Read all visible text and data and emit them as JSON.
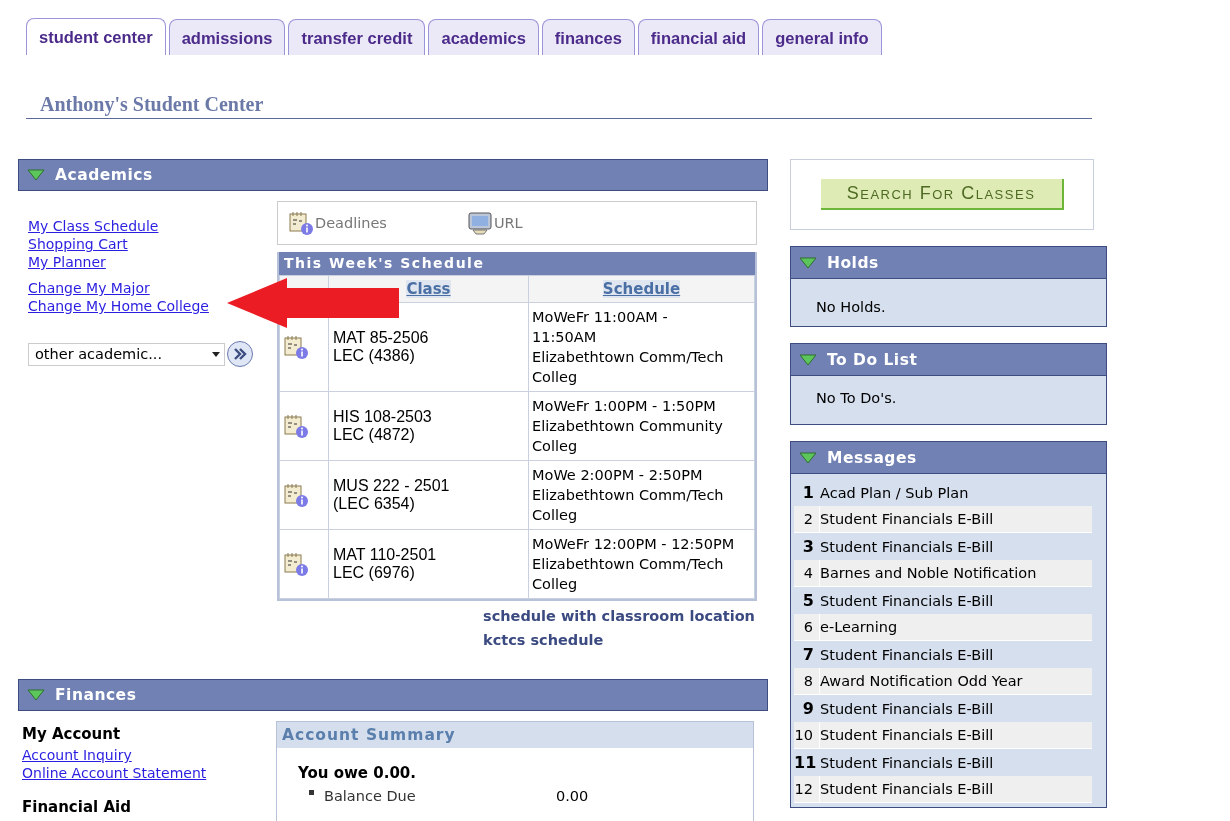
{
  "tabs": [
    {
      "label": "student center",
      "selected": true
    },
    {
      "label": "admissions",
      "selected": false
    },
    {
      "label": "transfer credit",
      "selected": false
    },
    {
      "label": "academics",
      "selected": false
    },
    {
      "label": "finances",
      "selected": false
    },
    {
      "label": "financial aid",
      "selected": false
    },
    {
      "label": "general info",
      "selected": false
    }
  ],
  "page_title": "Anthony's Student Center",
  "academics": {
    "title": "Academics",
    "expanded": true,
    "link_groups": [
      [
        "My Class Schedule",
        "Shopping Cart",
        "My Planner"
      ],
      [
        "Change My Major",
        "Change My Home College"
      ]
    ],
    "other_dropdown": {
      "value": "other academic..."
    },
    "toolbar": [
      {
        "label": "Deadlines",
        "kind": "calendar"
      },
      {
        "label": "URL",
        "kind": "monitor"
      }
    ],
    "schedule": {
      "title": "This Week's Schedule",
      "columns": [
        "Class",
        "Schedule"
      ],
      "rows": [
        {
          "class": "MAT 85-2506\nLEC (4386)",
          "schedule": "MoWeFr 11:00AM -\n11:50AM\nElizabethtown Comm/Tech\nColleg"
        },
        {
          "class": "HIS 108-2503\nLEC (4872)",
          "schedule": "MoWeFr 1:00PM - 1:50PM\nElizabethtown Community\nColleg"
        },
        {
          "class": "MUS 222 - 2501\n(LEC 6354)",
          "schedule": "MoWe 2:00PM - 2:50PM\nElizabethtown Comm/Tech\nColleg"
        },
        {
          "class": "MAT 110-2501\nLEC (6976)",
          "schedule": "MoWeFr 12:00PM - 12:50PM\nElizabethtown Comm/Tech\nColleg"
        }
      ]
    },
    "schedule_links": [
      "schedule with classroom location",
      "kctcs schedule"
    ]
  },
  "finances": {
    "title": "Finances",
    "expanded": true,
    "sections": [
      {
        "heading": "My Account",
        "links": [
          "Account Inquiry",
          "Online Account Statement"
        ]
      },
      {
        "heading": "Financial Aid"
      }
    ],
    "account_summary": {
      "title": "Account Summary",
      "owe": "You owe 0.00.",
      "items": [
        {
          "label": "Balance Due",
          "amount": "0.00"
        }
      ]
    }
  },
  "search_button": "Search For Classes",
  "holds": {
    "title": "Holds",
    "expanded": true,
    "text": "No Holds."
  },
  "todo": {
    "title": "To Do List",
    "expanded": true,
    "text": "No To Do's."
  },
  "messages": {
    "title": "Messages",
    "expanded": true,
    "items": [
      {
        "number": "1",
        "text": "Acad Plan / Sub Plan",
        "unread": true
      },
      {
        "number": "2",
        "text": "Student Financials E-Bill",
        "unread": false
      },
      {
        "number": "3",
        "text": "Student Financials E-Bill",
        "unread": true
      },
      {
        "number": "4",
        "text": "Barnes and Noble Notification",
        "unread": false
      },
      {
        "number": "5",
        "text": "Student Financials E-Bill",
        "unread": true
      },
      {
        "number": "6",
        "text": "e-Learning",
        "unread": false
      },
      {
        "number": "7",
        "text": "Student Financials E-Bill",
        "unread": true
      },
      {
        "number": "8",
        "text": "Award Notification Odd Year",
        "unread": false
      },
      {
        "number": "9",
        "text": "Student Financials E-Bill",
        "unread": true
      },
      {
        "number": "10",
        "text": "Student Financials E-Bill",
        "unread": false
      },
      {
        "number": "11",
        "text": "Student Financials E-Bill",
        "unread": true
      },
      {
        "number": "12",
        "text": "Student Financials E-Bill",
        "unread": false
      }
    ]
  }
}
